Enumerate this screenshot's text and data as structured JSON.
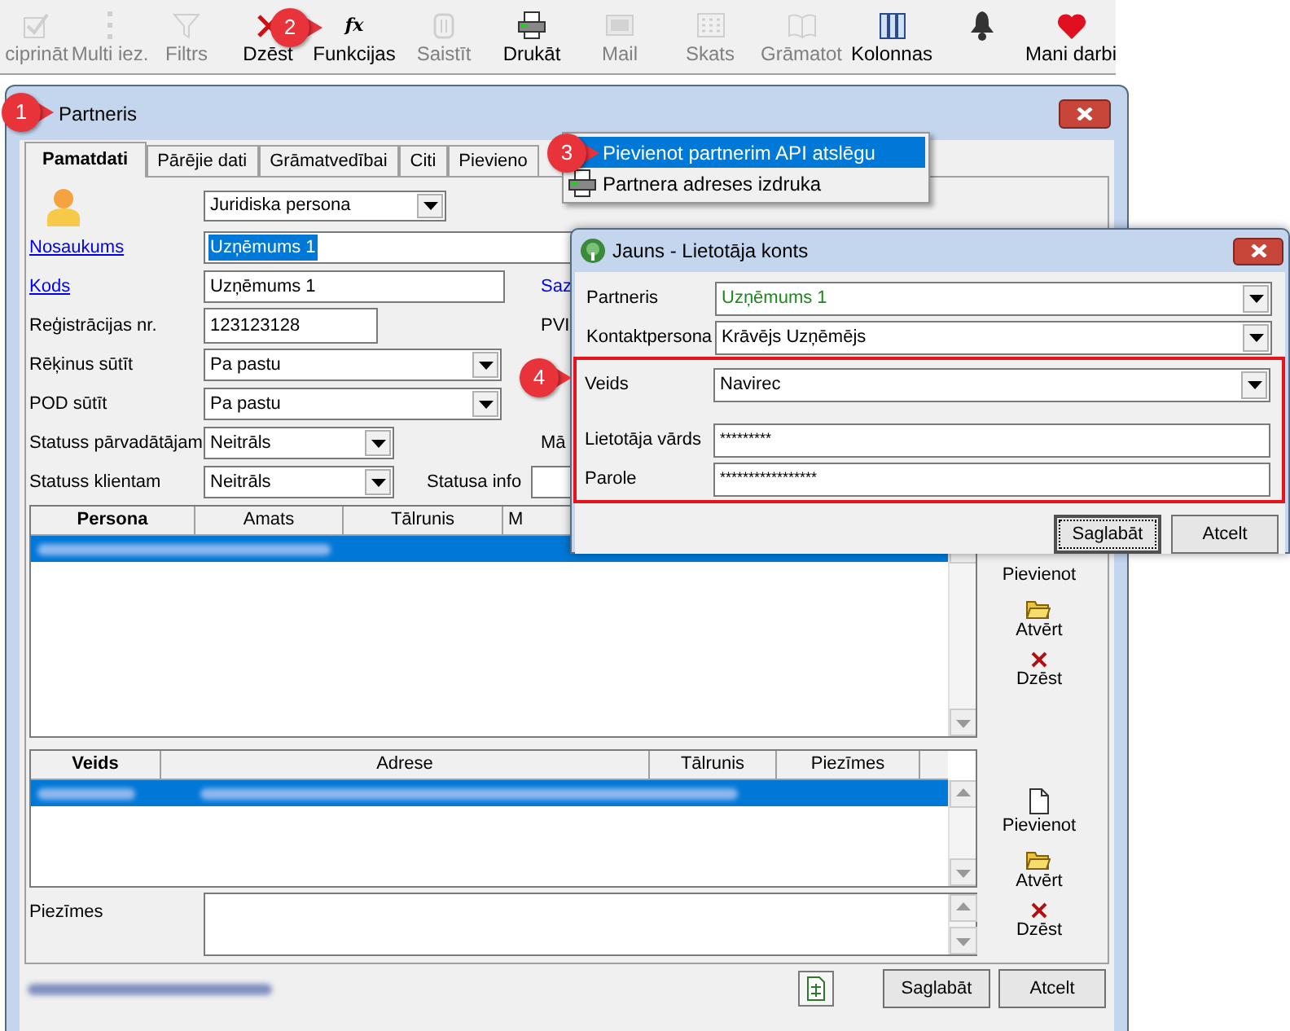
{
  "toolbar": {
    "buttons": [
      {
        "label": "ciprināt",
        "kind": "check",
        "disabled": true
      },
      {
        "label": "Multi iez.",
        "kind": "dots",
        "disabled": true
      },
      {
        "label": "Filtrs",
        "kind": "funnel",
        "disabled": true
      },
      {
        "label": "Dzēst",
        "kind": "cross",
        "disabled": false
      },
      {
        "label": "Funkcijas",
        "kind": "glyph",
        "icon_text": "fx",
        "disabled": false
      },
      {
        "label": "Saistīt",
        "kind": "clip",
        "disabled": true
      },
      {
        "label": "Drukāt",
        "kind": "printer",
        "disabled": false
      },
      {
        "label": "Mail",
        "kind": "mail",
        "disabled": true
      },
      {
        "label": "Skats",
        "kind": "grid",
        "disabled": true
      },
      {
        "label": "Grāmatot",
        "kind": "book",
        "disabled": true
      },
      {
        "label": "Kolonnas",
        "kind": "columns",
        "disabled": false
      },
      {
        "kind": "bell",
        "disabled": false
      },
      {
        "label": "Mani darbi",
        "kind": "heart",
        "disabled": false
      }
    ]
  },
  "window": {
    "title": "Partneris",
    "tabs": [
      {
        "label": "Pamatdati",
        "selected": true
      },
      {
        "label": "Pārējie dati",
        "selected": false
      },
      {
        "label": "Grāmatvedībai",
        "selected": false
      },
      {
        "label": "Citi",
        "selected": false
      },
      {
        "label": "Pievieno",
        "selected": false
      }
    ],
    "entity_type": "Juridiska persona",
    "fields": [
      {
        "label": "Nosaukums",
        "kind": "text",
        "value": "Uzņēmums 1",
        "link": true,
        "text_selected": true
      },
      {
        "label": "Kods",
        "kind": "text",
        "value": "Uzņēmums 1",
        "link": true,
        "text_selected": false,
        "side_label": "Saz",
        "side_link": true
      },
      {
        "label": "Reģistrācijas nr.",
        "kind": "short",
        "value": "123123128",
        "link": false,
        "side_label": "PVI",
        "side_link": false
      },
      {
        "label": "Rēķinus sūtīt",
        "kind": "dropdown",
        "value": "Pa pastu",
        "link": false
      },
      {
        "label": "POD sūtīt",
        "kind": "dropdown",
        "value": "Pa pastu",
        "link": false
      },
      {
        "label": "Statuss pārvadātājam",
        "kind": "small_dropdown",
        "value": "Neitrāls",
        "link": false,
        "side_label": "Mā",
        "side_link": false
      },
      {
        "label": "Statuss klientam",
        "kind": "small_dropdown",
        "value": "Neitrāls",
        "link": false,
        "extra_label": "Statusa info"
      }
    ],
    "persons_table": {
      "columns": [
        "Persona",
        "Amats",
        "Tālrunis",
        "M"
      ],
      "rows": [
        {
          "selected": true
        }
      ]
    },
    "persons_actions": [
      "Pievienot",
      "Atvērt",
      "Dzēst"
    ],
    "address_table": {
      "columns": [
        "Veids",
        "Adrese",
        "Tālrunis",
        "Piezīmes"
      ],
      "rows": [
        {
          "selected": true
        }
      ]
    },
    "address_actions": [
      "Pievienot",
      "Atvērt",
      "Dzēst"
    ],
    "notes_label": "Piezīmes",
    "buttons": [
      "Saglabāt",
      "Atcelt"
    ]
  },
  "context_menu": {
    "items": [
      {
        "label": "Pievienot partnerim API atslēgu",
        "kind": "plain",
        "selected": true
      },
      {
        "label": "Partnera adreses izdruka",
        "kind": "print",
        "selected": false
      }
    ]
  },
  "dialog": {
    "title": "Jauns - Lietotāja konts",
    "fields": [
      {
        "label": "Partneris",
        "kind": "dropdown",
        "value": "Uzņēmums 1",
        "highlighted": false,
        "color": "#1a8a1a"
      },
      {
        "label": "Kontaktpersona",
        "kind": "dropdown",
        "value": "Krāvējs Uzņēmējs",
        "highlighted": false
      },
      {
        "label": "Veids",
        "kind": "dropdown",
        "value": "Navirec",
        "highlighted": true
      },
      {
        "label": "Lietotāja vārds",
        "kind": "text",
        "value": "*********",
        "highlighted": true
      },
      {
        "label": "Parole",
        "kind": "text",
        "value": "*****************",
        "highlighted": true
      }
    ],
    "buttons": [
      {
        "label": "Saglabāt",
        "focused": true
      },
      {
        "label": "Atcelt",
        "focused": false
      }
    ]
  },
  "callouts": [
    "1",
    "2",
    "3",
    "4"
  ]
}
